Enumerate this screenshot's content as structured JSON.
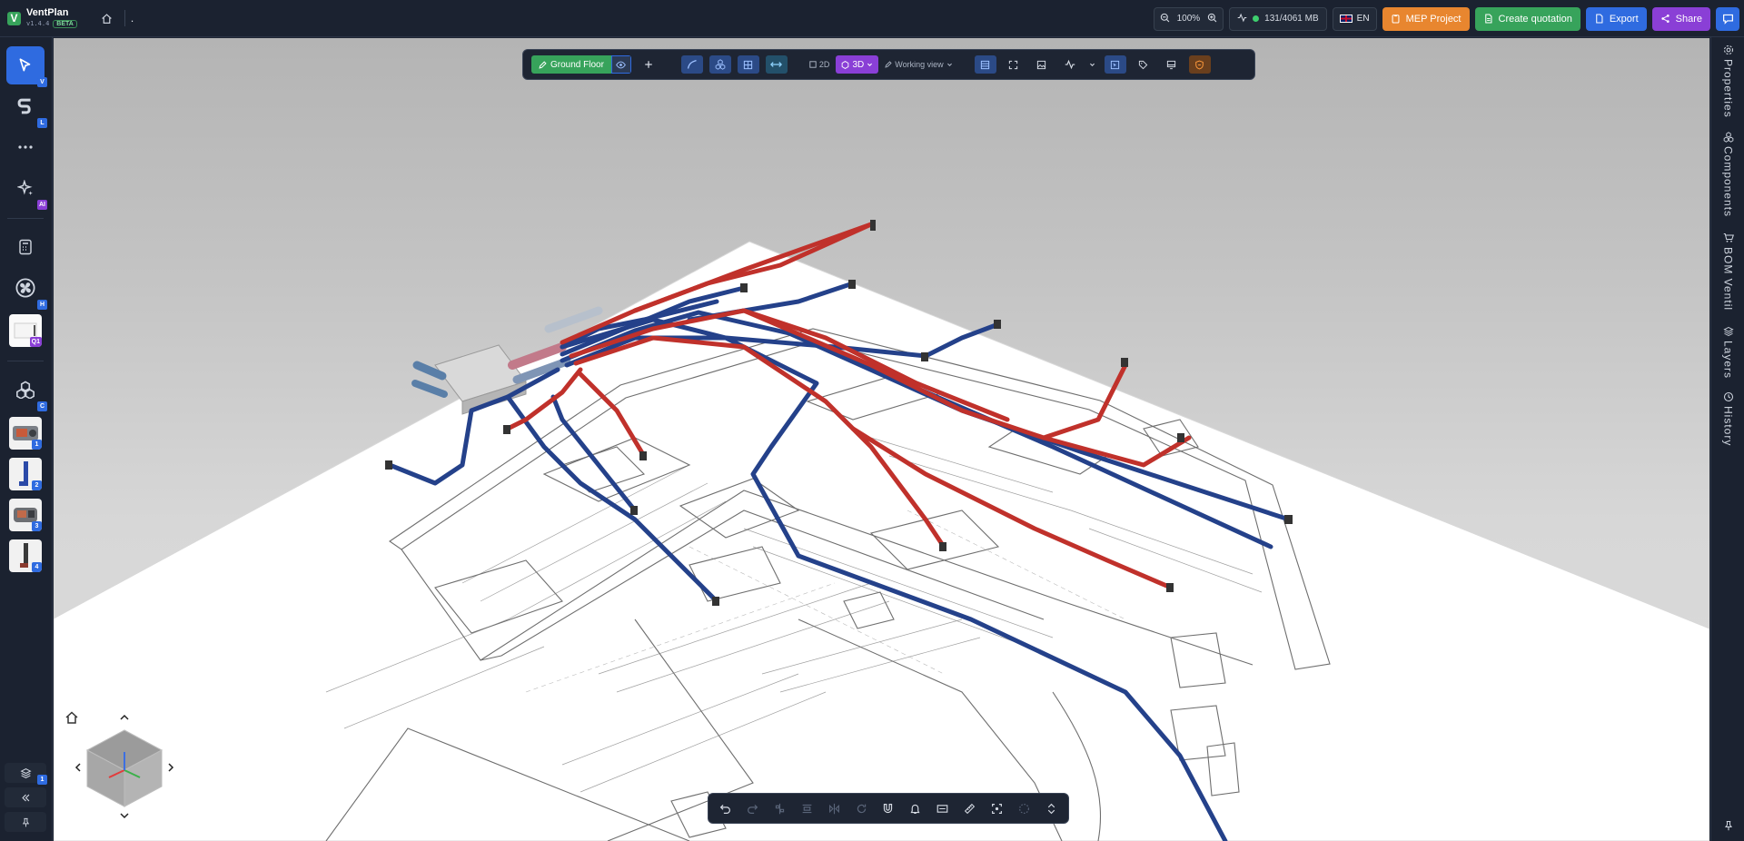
{
  "app": {
    "name": "VentPlan",
    "version": "v1.4.4",
    "badge": "BETA",
    "breadcrumb": "."
  },
  "header": {
    "zoom": "100%",
    "memory": "131/4061 MB",
    "language": "EN",
    "mep_project": "MEP Project",
    "create_quotation": "Create quotation",
    "export": "Export",
    "share": "Share"
  },
  "left_toolbar": {
    "items": [
      {
        "name": "select-tool",
        "shortcut": "V"
      },
      {
        "name": "duct-tool",
        "shortcut": "L"
      },
      {
        "name": "more-tools",
        "shortcut": ""
      },
      {
        "name": "ai-tool",
        "shortcut": "AI"
      },
      {
        "name": "calculator-tool",
        "shortcut": ""
      },
      {
        "name": "fan-tool",
        "shortcut": "H"
      },
      {
        "name": "unit-thumbnail",
        "shortcut": "Q1"
      },
      {
        "name": "components-tool",
        "shortcut": "C"
      },
      {
        "name": "recent-component-1",
        "shortcut": "1"
      },
      {
        "name": "recent-component-2",
        "shortcut": "2"
      },
      {
        "name": "recent-component-3",
        "shortcut": "3"
      },
      {
        "name": "recent-component-4",
        "shortcut": "4"
      }
    ],
    "layers_count": "1"
  },
  "right_sidebar": {
    "tabs": [
      "Properties",
      "Components",
      "BOM Ventil",
      "Layers",
      "History"
    ]
  },
  "view_toolbar": {
    "floor": "Ground Floor",
    "mode_2d": "2D",
    "mode_3d": "3D",
    "view": "Working view"
  },
  "colors": {
    "supply_duct": "#c0312b",
    "extract_duct": "#24418a",
    "accent": "#2f6be0",
    "brand_green": "#37a35b"
  }
}
